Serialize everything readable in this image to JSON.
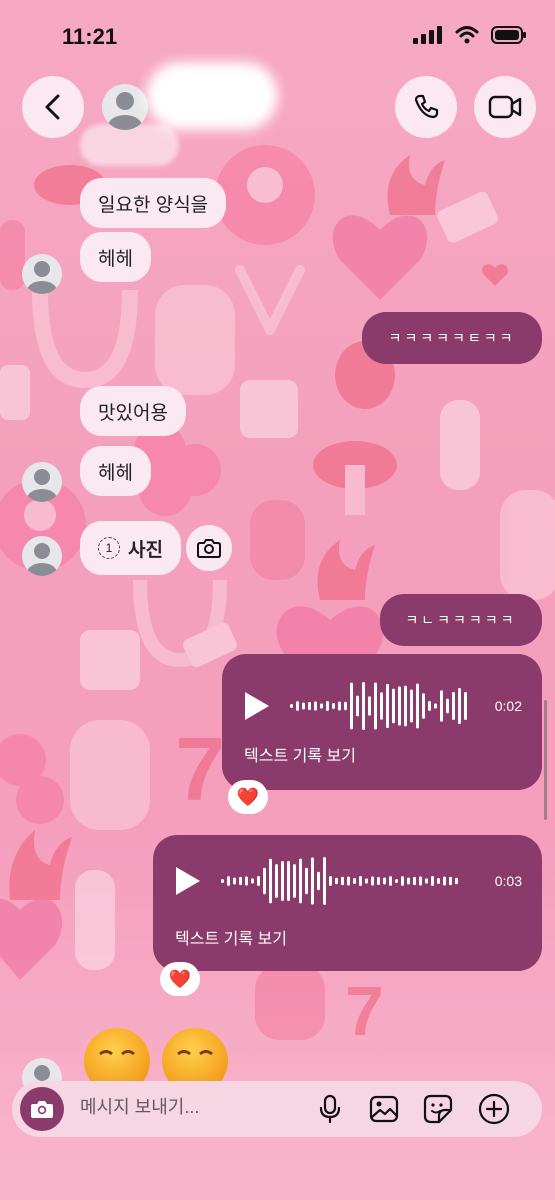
{
  "status_bar": {
    "time": "11:21"
  },
  "header": {
    "back_icon": "chevron-left-icon",
    "call_icon": "phone-icon",
    "video_icon": "video-camera-icon"
  },
  "messages": {
    "received_1": "일요한 양식을",
    "received_2": "헤헤",
    "sent_1": "ㅋㅋㅋㅋㅋㅌㅋㅋ",
    "received_3": "맛있어용",
    "received_4": "헤헤",
    "photo_count": "1",
    "photo_label": "사진",
    "sent_2": "ㅋㄴㅋㅋㅋㅋㅋ",
    "voice_1": {
      "duration": "0:02",
      "transcript_link": "텍스트 기록 보기",
      "reaction": "❤️"
    },
    "voice_2": {
      "duration": "0:03",
      "transcript_link": "텍스트 기록 보기",
      "reaction": "❤️"
    }
  },
  "composer": {
    "placeholder": "메시지 보내기..."
  },
  "colors": {
    "sent_bubble": "#8b3a6c",
    "received_bubble": "#fbe9f1",
    "background": "#f4a0bc"
  }
}
